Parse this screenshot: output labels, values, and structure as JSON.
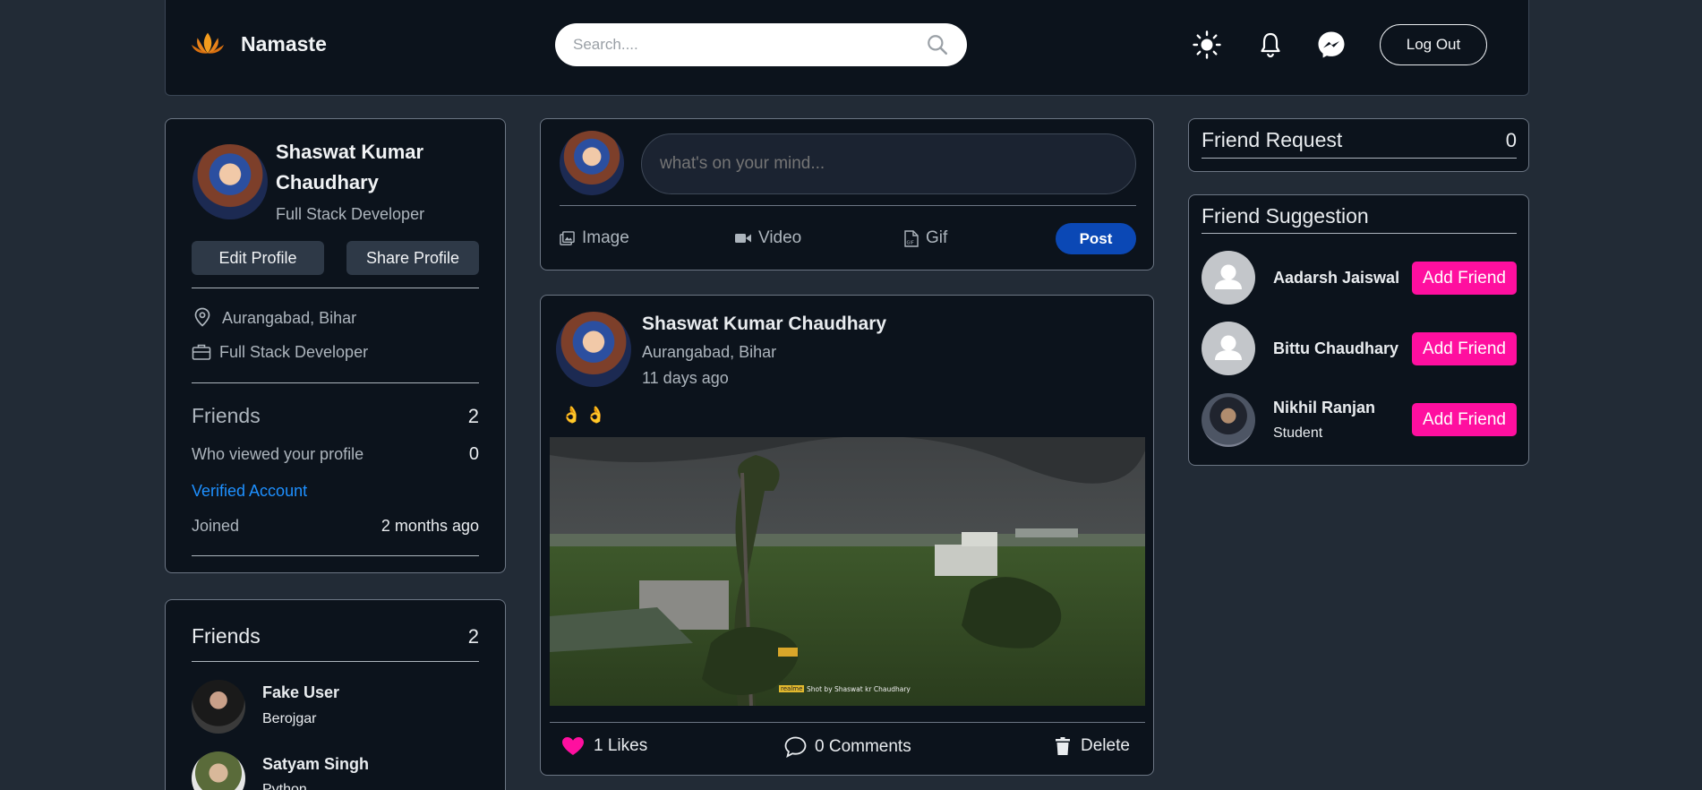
{
  "navbar": {
    "brand": "Namaste",
    "search_placeholder": "Search....",
    "logout_label": "Log Out"
  },
  "profile": {
    "name_line1": "Shaswat Kumar",
    "name_line2": "Chaudhary",
    "title": "Full Stack Developer",
    "edit_label": "Edit Profile",
    "share_label": "Share Profile",
    "location": "Aurangabad, Bihar",
    "occupation": "Full Stack Developer",
    "friends_label": "Friends",
    "friends_count": "2",
    "viewed_label": "Who viewed your profile",
    "viewed_count": "0",
    "verified_label": "Verified Account",
    "joined_label": "Joined",
    "joined_value": "2 months ago"
  },
  "friends_card": {
    "title": "Friends",
    "count": "2",
    "items": [
      {
        "name": "Fake User",
        "subtitle": "Berojgar"
      },
      {
        "name": "Satyam Singh",
        "subtitle": "Python"
      }
    ]
  },
  "composer": {
    "placeholder": "what's on your mind...",
    "image_label": "Image",
    "video_label": "Video",
    "gif_label": "Gif",
    "post_label": "Post"
  },
  "post": {
    "author": "Shaswat Kumar Chaudhary",
    "location": "Aurangabad, Bihar",
    "time": "11 days ago",
    "text": "👌 👌",
    "watermark_brand": "realme",
    "watermark_text": "Shot by Shaswat kr Chaudhary",
    "likes_label": "1 Likes",
    "comments_label": "0 Comments",
    "delete_label": "Delete"
  },
  "friend_request": {
    "title": "Friend Request",
    "count": "0"
  },
  "suggestions": {
    "title": "Friend Suggestion",
    "add_label": "Add Friend",
    "items": [
      {
        "name": "Aadarsh Jaiswal",
        "subtitle": ""
      },
      {
        "name": "Bittu Chaudhary",
        "subtitle": ""
      },
      {
        "name": "Nikhil Ranjan",
        "subtitle": "Student"
      }
    ]
  },
  "colors": {
    "page_bg": "#222b36",
    "card_bg": "#0c131c",
    "accent_pink": "#ff0f9f",
    "post_blue": "#0b48b5",
    "verified_blue": "#1e90ff"
  }
}
